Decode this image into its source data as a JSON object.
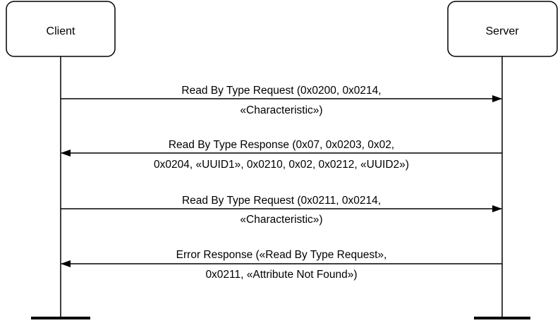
{
  "participants": {
    "client": {
      "label": "Client"
    },
    "server": {
      "label": "Server"
    }
  },
  "messages": [
    {
      "direction": "client-to-server",
      "line1": "Read By Type Request (0x0200, 0x0214,",
      "line2": "«Characteristic»)"
    },
    {
      "direction": "server-to-client",
      "line1": "Read By Type Response (0x07, 0x0203, 0x02,",
      "line2": "0x0204, «UUID1», 0x0210, 0x02, 0x0212, «UUID2»)"
    },
    {
      "direction": "client-to-server",
      "line1": "Read By Type Request (0x0211, 0x0214,",
      "line2": "«Characteristic»)"
    },
    {
      "direction": "server-to-client",
      "line1": "Error Response («Read By Type Request»,",
      "line2": "0x0211, «Attribute Not Found»)"
    }
  ],
  "colors": {
    "stroke": "#000000",
    "background": "#ffffff"
  }
}
